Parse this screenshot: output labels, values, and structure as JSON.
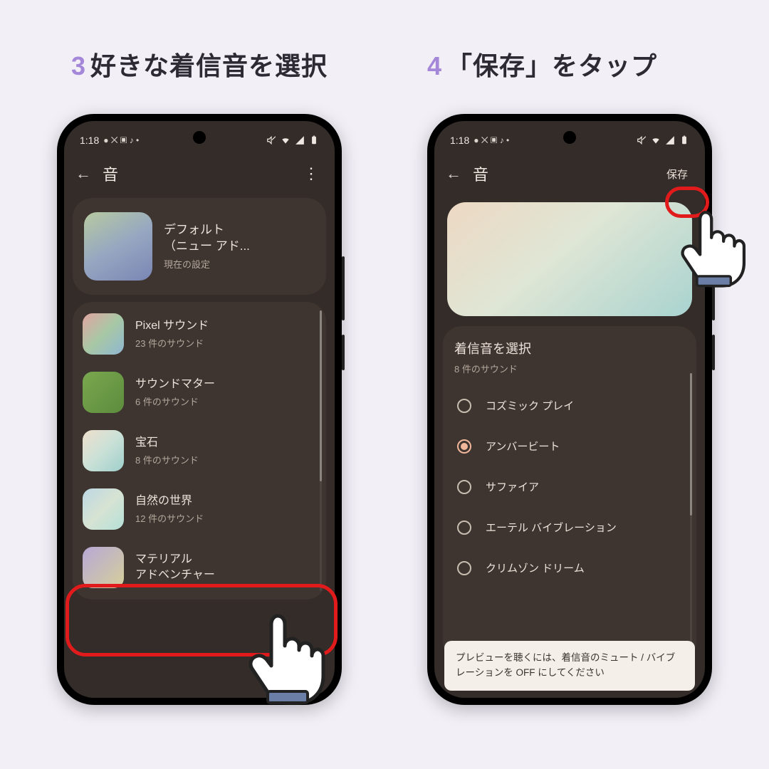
{
  "headings": {
    "left_num": "3",
    "left_text": "好きな着信音を選択",
    "right_num": "4",
    "right_text": "「保存」をタップ"
  },
  "status": {
    "time": "1:18"
  },
  "appbar": {
    "title": "音",
    "save_label": "保存"
  },
  "left": {
    "default_title": "デフォルト\n（ニュー アド...",
    "default_sub": "現在の設定",
    "items": [
      {
        "title": "Pixel サウンド",
        "sub": "23 件のサウンド",
        "grad": "linear-gradient(135deg,#e2a3a2,#a8c8a4,#8fb7d3)"
      },
      {
        "title": "サウンドマター",
        "sub": "6 件のサウンド",
        "grad": "linear-gradient(135deg,#7aa84f,#5c8c3d)"
      },
      {
        "title": "宝石",
        "sub": "8 件のサウンド",
        "grad": "linear-gradient(135deg,#efe0cd,#cbe1d7,#9ecfcb)"
      },
      {
        "title": "自然の世界",
        "sub": "12 件のサウンド",
        "grad": "linear-gradient(135deg,#bcd7e2,#d6e3d3,#b6e0d8)"
      },
      {
        "title": "マテリアル\nアドベンチャー",
        "sub": "",
        "grad": "linear-gradient(135deg,#b7a8d6,#d6cf9a)"
      }
    ]
  },
  "right": {
    "panel_title": "着信音を選択",
    "panel_sub": "8 件のサウンド",
    "options": [
      {
        "label": "コズミック プレイ",
        "checked": false
      },
      {
        "label": "アンバービート",
        "checked": true
      },
      {
        "label": "サファイア",
        "checked": false
      },
      {
        "label": "エーテル バイブレーション",
        "checked": false
      },
      {
        "label": "クリムゾン ドリーム",
        "checked": false
      }
    ],
    "snack": "プレビューを聴くには、着信音のミュート / バイブレーションを OFF にしてください"
  }
}
